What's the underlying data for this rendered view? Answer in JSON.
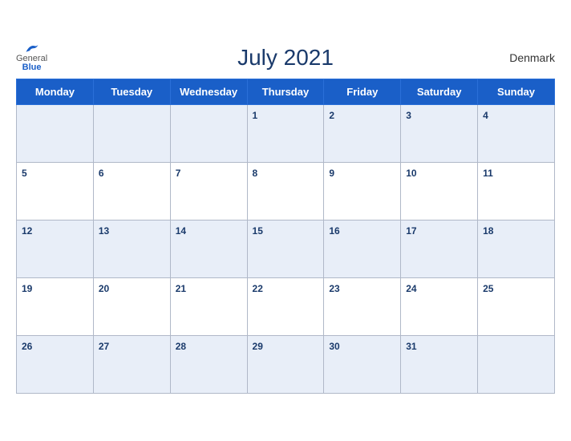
{
  "header": {
    "title": "July 2021",
    "country": "Denmark",
    "logo": {
      "line1": "General",
      "line2": "Blue"
    }
  },
  "weekdays": [
    "Monday",
    "Tuesday",
    "Wednesday",
    "Thursday",
    "Friday",
    "Saturday",
    "Sunday"
  ],
  "weeks": [
    [
      null,
      null,
      null,
      1,
      2,
      3,
      4
    ],
    [
      5,
      6,
      7,
      8,
      9,
      10,
      11
    ],
    [
      12,
      13,
      14,
      15,
      16,
      17,
      18
    ],
    [
      19,
      20,
      21,
      22,
      23,
      24,
      25
    ],
    [
      26,
      27,
      28,
      29,
      30,
      31,
      null
    ]
  ],
  "colors": {
    "header_bg": "#1a5fc8",
    "odd_row_bg": "#e8eef8",
    "even_row_bg": "#ffffff",
    "title_color": "#1a3a6b",
    "border": "#b0b8c8"
  }
}
